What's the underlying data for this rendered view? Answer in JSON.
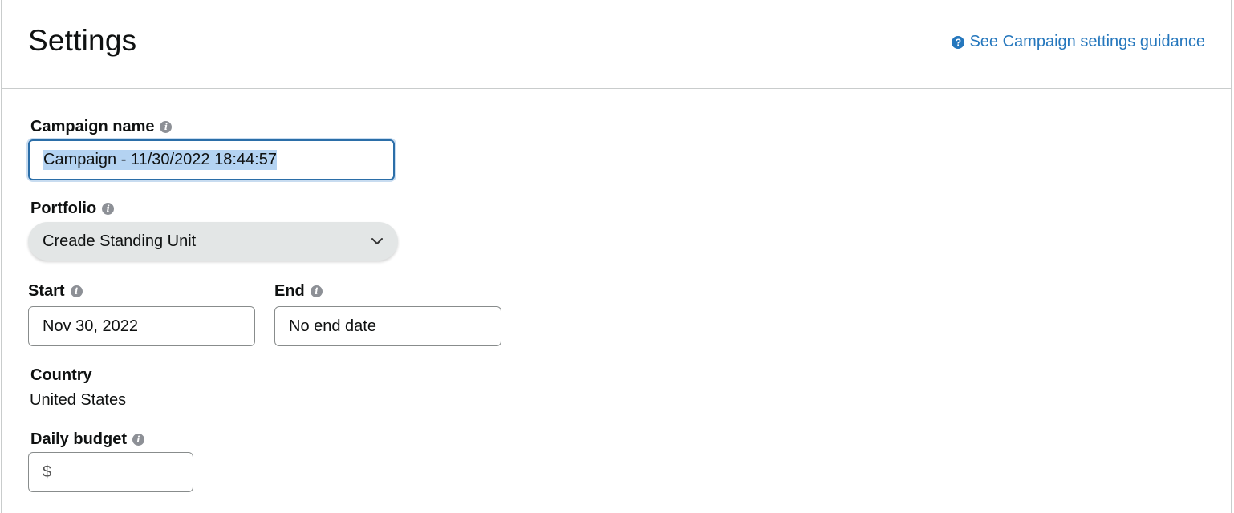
{
  "header": {
    "title": "Settings",
    "guidance_link": "See Campaign settings guidance",
    "guidance_icon": "?"
  },
  "form": {
    "campaign_name": {
      "label": "Campaign name",
      "value": "Campaign - 11/30/2022 18:44:57"
    },
    "portfolio": {
      "label": "Portfolio",
      "selected": "Creade Standing Unit"
    },
    "start": {
      "label": "Start",
      "value": "Nov 30, 2022"
    },
    "end": {
      "label": "End",
      "value": "No end date"
    },
    "country": {
      "label": "Country",
      "value": "United States"
    },
    "daily_budget": {
      "label": "Daily budget",
      "currency_symbol": "$",
      "value": ""
    }
  },
  "icons": {
    "info": "i",
    "chevron": "chevron-down-icon"
  },
  "colors": {
    "link": "#2577bd",
    "focus_border": "#2b6ea8",
    "select_bg": "#e3e6e6",
    "text_selection": "#b4d3f2",
    "info_icon": "#8d9096"
  }
}
